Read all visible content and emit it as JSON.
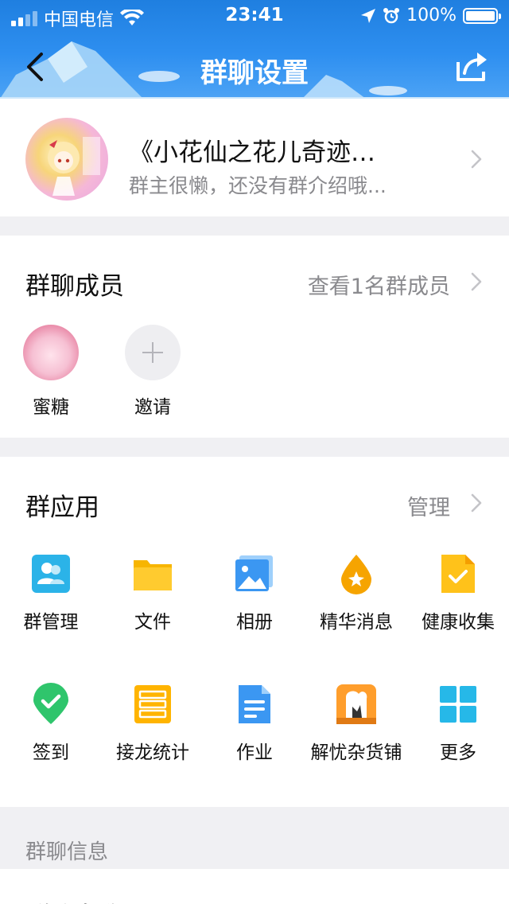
{
  "status_bar": {
    "carrier": "中国电信",
    "time": "23:41",
    "battery": "100%"
  },
  "header": {
    "title": "群聊设置"
  },
  "group": {
    "name": "《小花仙之花儿奇迹…",
    "description": "群主很懒，还没有群介绍哦..."
  },
  "members": {
    "title": "群聊成员",
    "view_all": "查看1名群成员",
    "list": [
      {
        "name": "蜜糖"
      },
      {
        "name": "邀请"
      }
    ]
  },
  "apps": {
    "title": "群应用",
    "manage": "管理",
    "items": [
      {
        "label": "群管理",
        "icon": "group-manage-icon"
      },
      {
        "label": "文件",
        "icon": "folder-icon"
      },
      {
        "label": "相册",
        "icon": "album-icon"
      },
      {
        "label": "精华消息",
        "icon": "highlight-icon"
      },
      {
        "label": "健康收集",
        "icon": "health-icon"
      },
      {
        "label": "签到",
        "icon": "checkin-icon"
      },
      {
        "label": "接龙统计",
        "icon": "relay-icon"
      },
      {
        "label": "作业",
        "icon": "homework-icon"
      },
      {
        "label": "解忧杂货铺",
        "icon": "store-icon"
      },
      {
        "label": "更多",
        "icon": "more-grid-icon"
      }
    ]
  },
  "info": {
    "title": "群聊信息",
    "name_label": "群聊名称"
  },
  "colors": {
    "header_blue": "#2e8ff0",
    "accent_blue": "#2f86e6",
    "gray_text": "#8a8a8e"
  }
}
